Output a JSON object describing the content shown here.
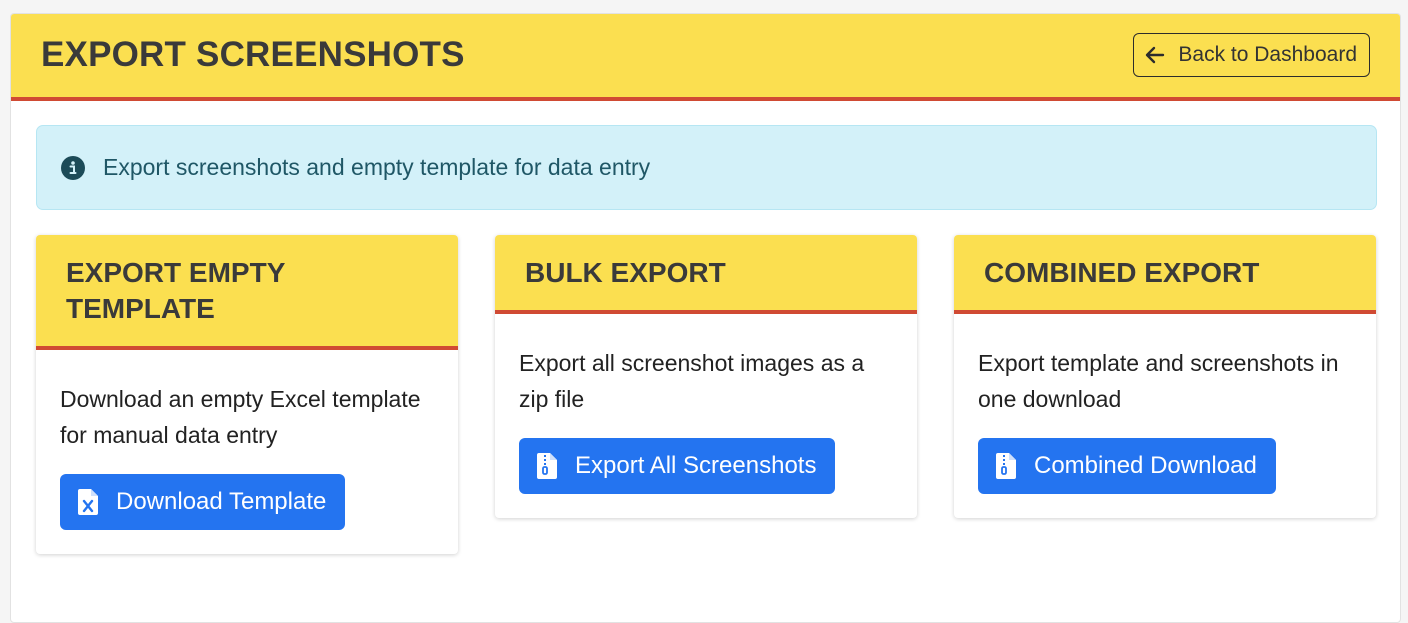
{
  "header": {
    "title": "EXPORT SCREENSHOTS",
    "back_label": "Back to Dashboard",
    "back_icon": "arrow-left-icon"
  },
  "alert": {
    "icon": "info-circle-icon",
    "text": "Export screenshots and empty template for data entry"
  },
  "cards": [
    {
      "title": "EXPORT EMPTY TEMPLATE",
      "description": "Download an empty Excel template for manual data entry",
      "button_label": "Download Template",
      "button_icon": "file-excel-icon"
    },
    {
      "title": "BULK EXPORT",
      "description": "Export all screenshot images as a zip file",
      "button_label": "Export All Screenshots",
      "button_icon": "file-zip-icon"
    },
    {
      "title": "COMBINED EXPORT",
      "description": "Export template and screenshots in one download",
      "button_label": "Combined Download",
      "button_icon": "file-zip-icon"
    }
  ],
  "colors": {
    "header_bg": "#fbdf50",
    "header_border": "#d04a33",
    "primary": "#2474f0",
    "alert_bg": "#d3f1f9"
  }
}
